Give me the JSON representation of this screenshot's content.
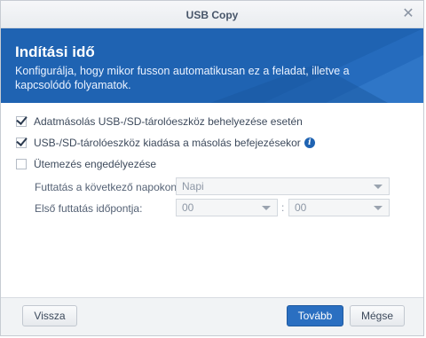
{
  "window": {
    "title": "USB Copy"
  },
  "banner": {
    "heading": "Indítási idő",
    "description": "Konfigurálja, hogy mikor fusson automatikusan ez a feladat, illetve a kapcsolódó folyamatok."
  },
  "options": {
    "on_insert": {
      "label": "Adatmásolás USB-/SD-tárolóeszköz behelyezése esetén",
      "checked": true
    },
    "eject_after": {
      "label": "USB-/SD-tárolóeszköz kiadása a másolás befejezésekor",
      "checked": true
    },
    "schedule": {
      "label": "Ütemezés engedélyezése",
      "checked": false
    }
  },
  "schedule": {
    "days_label": "Futtatás a következő napokon:",
    "days_value": "Napi",
    "first_run_label": "Első futtatás időpontja:",
    "hour_value": "00",
    "separator": ":",
    "minute_value": "00"
  },
  "footer": {
    "back_label": "Vissza",
    "next_label": "Tovább",
    "cancel_label": "Mégse"
  },
  "colors": {
    "accent": "#1f63b2",
    "primary_button": "#2a6fc1"
  }
}
